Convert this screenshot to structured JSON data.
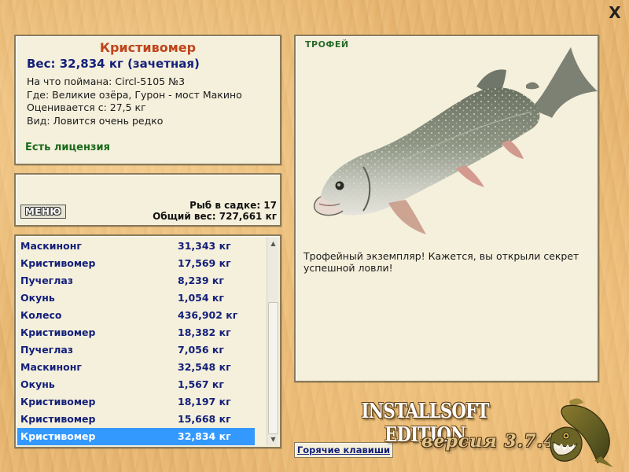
{
  "close_label": "X",
  "info": {
    "name": "Кристивомер",
    "weight": "Вес: 32,834 кг (зачетная)",
    "caught_with": "На что поймана: Circl-5105 №3",
    "where": "Где: Великие озёра, Гурон - мост Макино",
    "valued_from": "Оценивается с: 27,5 кг",
    "kind": "Вид: Ловится очень редко",
    "license": "Есть лицензия"
  },
  "cage": {
    "menu_label": "МЕНЮ",
    "fish_count": "Рыб в садке: 17",
    "total_weight": "Общий вес: 727,661 кг"
  },
  "fish_list": [
    {
      "name": "Маскинонг",
      "weight": "31,343 кг"
    },
    {
      "name": "Кристивомер",
      "weight": "17,569 кг"
    },
    {
      "name": "Пучеглаз",
      "weight": "8,239 кг"
    },
    {
      "name": "Окунь",
      "weight": "1,054 кг"
    },
    {
      "name": "Колесо",
      "weight": "436,902 кг"
    },
    {
      "name": "Кристивомер",
      "weight": "18,382 кг"
    },
    {
      "name": "Пучеглаз",
      "weight": "7,056 кг"
    },
    {
      "name": "Маскинонг",
      "weight": "32,548 кг"
    },
    {
      "name": "Окунь",
      "weight": "1,567 кг"
    },
    {
      "name": "Кристивомер",
      "weight": "18,197 кг"
    },
    {
      "name": "Кристивомер",
      "weight": "15,668 кг"
    },
    {
      "name": "Кристивомер",
      "weight": "32,834 кг"
    }
  ],
  "selected_index": 11,
  "trophy": {
    "label": "ТРОФЕЙ",
    "text": "Трофейный экземпляр! Кажется, вы открыли секрет успешной ловли!"
  },
  "hotkeys_label": "Горячие клавиши",
  "edition_label": "INSTALLSOFT EDITION",
  "version_label": "версия 3.7.4",
  "colors": {
    "wood": "#e9b974",
    "panel": "#f5f0dc",
    "fish_name": "#c0441a",
    "weight": "#14207a",
    "license": "#1a6a1a",
    "selection": "#3399ff"
  }
}
